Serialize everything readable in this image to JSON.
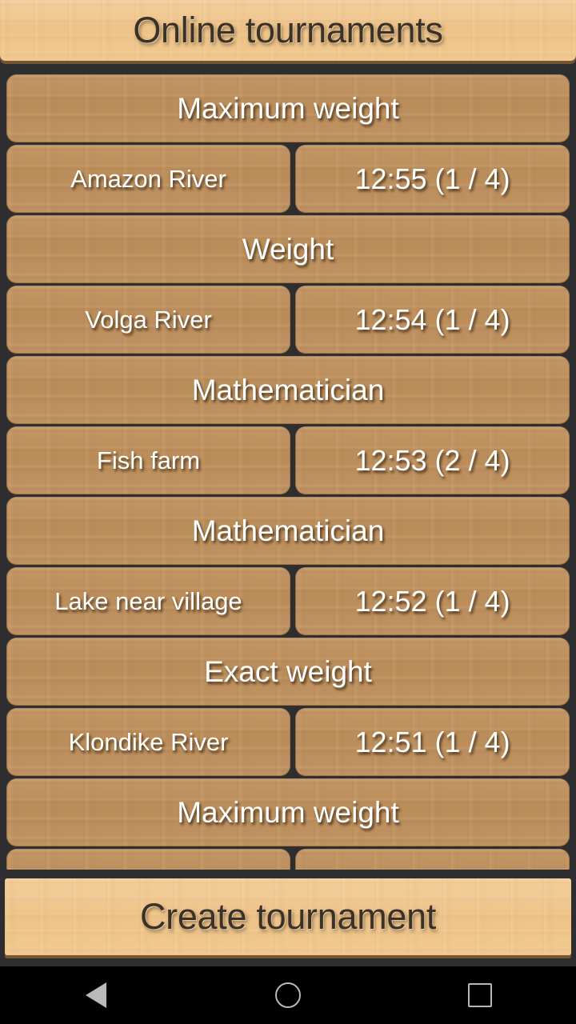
{
  "header": {
    "title": "Online tournaments"
  },
  "list": {
    "groups": [
      {
        "mode": "Maximum weight",
        "place": "Amazon River",
        "time": "12:55 (1 / 4)"
      },
      {
        "mode": "Weight",
        "place": "Volga River",
        "time": "12:54 (1 / 4)"
      },
      {
        "mode": "Mathematician",
        "place": "Fish farm",
        "time": "12:53 (2 / 4)"
      },
      {
        "mode": "Mathematician",
        "place": "Lake near village",
        "time": "12:52 (1 / 4)"
      },
      {
        "mode": "Exact weight",
        "place": "Klondike River",
        "time": "12:51 (1 / 4)"
      },
      {
        "mode": "Maximum weight",
        "place": "",
        "time": ""
      }
    ]
  },
  "footer": {
    "create_label": "Create tournament"
  },
  "navbar": {
    "back": "back-triangle-icon",
    "home": "home-circle-icon",
    "recents": "recents-square-icon"
  },
  "colors": {
    "background": "#2e2e30",
    "wood_light": "#efc68d",
    "wood_mid": "#bd8f5c",
    "title_text": "#3b3126",
    "item_text": "#ffffff",
    "nav_icon": "#b9b9b9"
  }
}
